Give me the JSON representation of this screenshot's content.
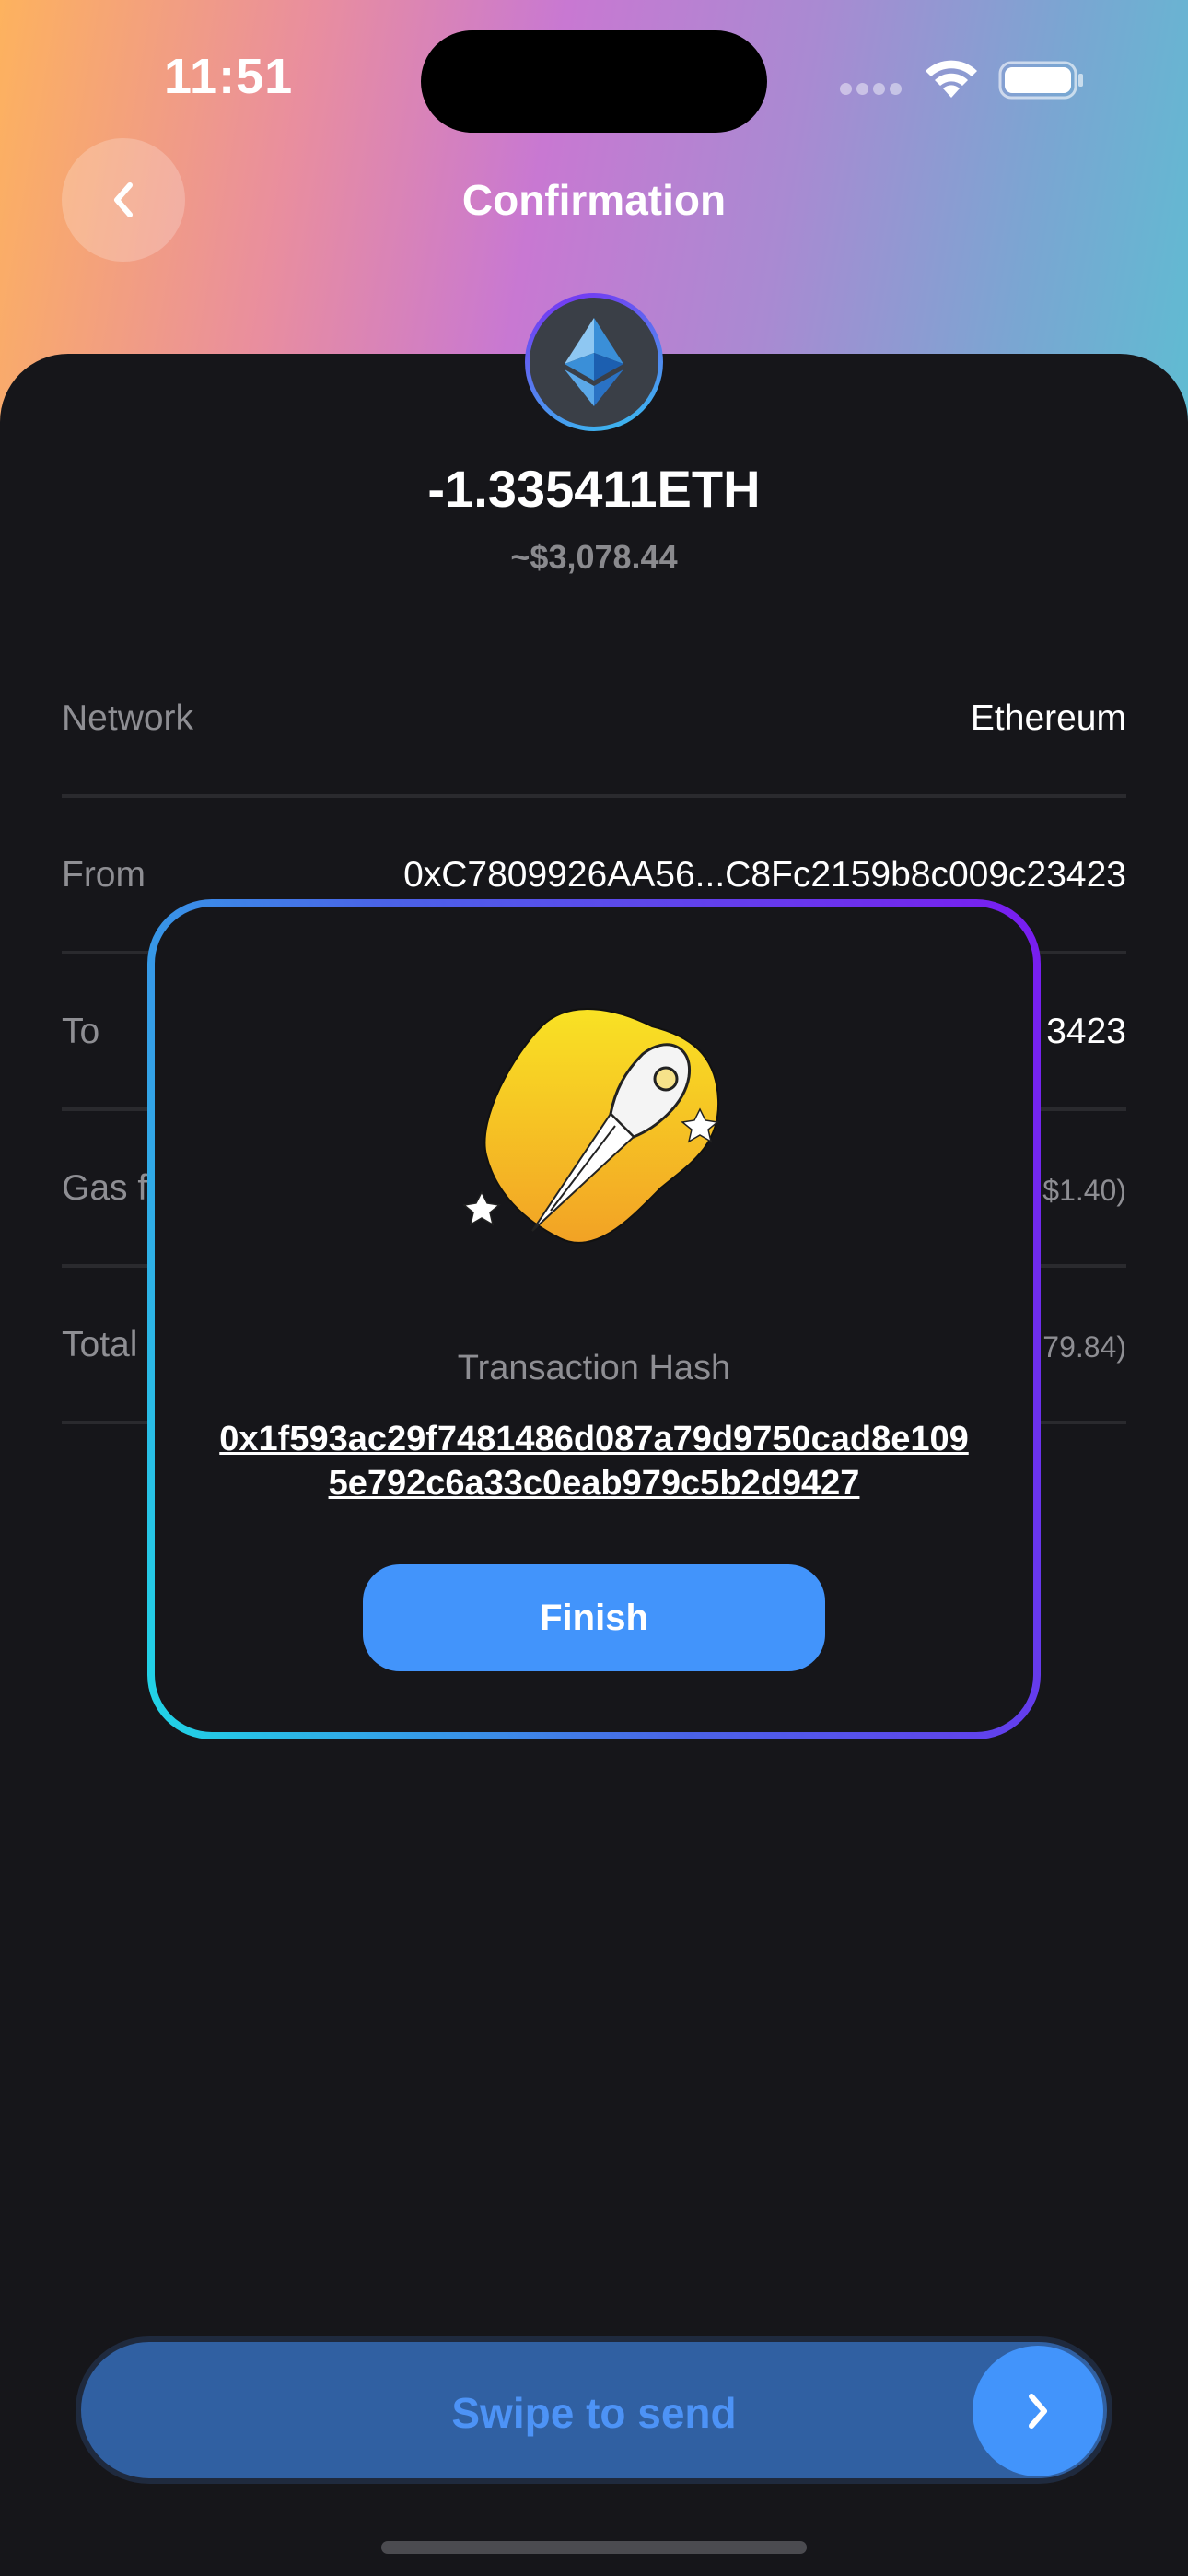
{
  "status_bar": {
    "time": "11:51"
  },
  "header": {
    "title": "Confirmation",
    "back_icon": "chevron-left-icon"
  },
  "token": {
    "icon": "ethereum-icon",
    "amount": "-1.335411ETH",
    "fiat_amount": "~$3,078.44"
  },
  "details": [
    {
      "label": "Network",
      "value": "Ethereum"
    },
    {
      "label": "From",
      "value": "0xC7809926AA56...C8Fc2159b8c009c23423"
    },
    {
      "label": "To",
      "value": "3423"
    },
    {
      "label": "Gas fe",
      "value": "$1.40)"
    },
    {
      "label": "Total",
      "value": "79.84)"
    }
  ],
  "modal": {
    "illustration": "rocket-illustration",
    "hash_label": "Transaction Hash",
    "hash_value": "0x1f593ac29f7481486d087a79d9750cad8e1095e792c6a33c0eab979c5b2d9427",
    "finish_label": "Finish"
  },
  "swipe": {
    "label": "Swipe to send",
    "knob_icon": "chevron-right-icon"
  },
  "colors": {
    "accent": "#4294fb",
    "background": "#16161a",
    "muted_text": "#8e8e93",
    "modal_gradient_start": "#20d6e6",
    "modal_gradient_end": "#7a1cf0"
  }
}
